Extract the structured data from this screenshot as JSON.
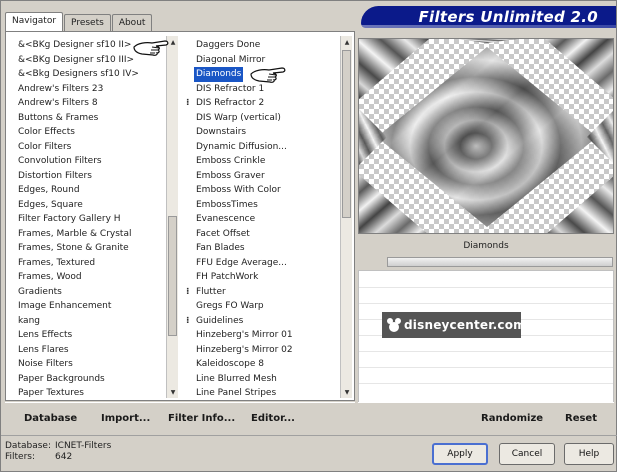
{
  "app": {
    "banner_title": "Filters Unlimited 2.0"
  },
  "tabs": [
    {
      "label": "Navigator",
      "active": true
    },
    {
      "label": "Presets",
      "active": false
    },
    {
      "label": "About",
      "active": false
    }
  ],
  "categories": [
    "&<BKg Designer sf10 II>",
    "&<BKg Designer sf10 III>",
    "&<Bkg Designers sf10 IV>",
    "Andrew's Filters 23",
    "Andrew's Filters 8",
    "Buttons & Frames",
    "Color Effects",
    "Color Filters",
    "Convolution Filters",
    "Distortion Filters",
    "Edges, Round",
    "Edges, Square",
    "Filter Factory Gallery H",
    "Frames, Marble & Crystal",
    "Frames, Stone & Granite",
    "Frames, Textured",
    "Frames, Wood",
    "Gradients",
    "Image Enhancement",
    "kang",
    "Lens Effects",
    "Lens Flares",
    "Noise Filters",
    "Paper Backgrounds",
    "Paper Textures"
  ],
  "filters": [
    {
      "label": "Daggers Done",
      "group": false
    },
    {
      "label": "Diagonal Mirror",
      "group": false
    },
    {
      "label": "Diamonds",
      "group": false,
      "selected": true
    },
    {
      "label": "DIS Refractor 1",
      "group": false
    },
    {
      "label": "DIS Refractor 2",
      "group": true
    },
    {
      "label": "DIS Warp (vertical)",
      "group": false
    },
    {
      "label": "Downstairs",
      "group": false
    },
    {
      "label": "Dynamic Diffusion...",
      "group": false
    },
    {
      "label": "Emboss Crinkle",
      "group": false
    },
    {
      "label": "Emboss Graver",
      "group": false
    },
    {
      "label": "Emboss With Color",
      "group": false
    },
    {
      "label": "EmbossTimes",
      "group": false
    },
    {
      "label": "Evanescence",
      "group": false
    },
    {
      "label": "Facet Offset",
      "group": false
    },
    {
      "label": "Fan Blades",
      "group": false
    },
    {
      "label": "FFU Edge Average...",
      "group": false
    },
    {
      "label": "FH PatchWork",
      "group": false
    },
    {
      "label": "Flutter",
      "group": true
    },
    {
      "label": "Gregs FO Warp",
      "group": false
    },
    {
      "label": "Guidelines",
      "group": true
    },
    {
      "label": "Hinzeberg's Mirror 01",
      "group": false
    },
    {
      "label": "Hinzeberg's Mirror 02",
      "group": false
    },
    {
      "label": "Kaleidoscope 8",
      "group": false
    },
    {
      "label": "Line Blurred Mesh",
      "group": false
    },
    {
      "label": "Line Panel Stripes",
      "group": false
    }
  ],
  "preview": {
    "filter_name": "Diamonds"
  },
  "watermark": {
    "text": "disneycenter.com"
  },
  "left_actions": {
    "database": "Database",
    "import": "Import...",
    "filter_info": "Filter Info...",
    "editor": "Editor..."
  },
  "right_actions": {
    "randomize": "Randomize",
    "reset": "Reset"
  },
  "status": {
    "database_label": "Database:",
    "database_value": "ICNET-Filters",
    "filters_label": "Filters:",
    "filters_value": "642"
  },
  "dialog": {
    "apply": "Apply",
    "cancel": "Cancel",
    "help": "Help"
  },
  "colors": {
    "banner": "#0b1a8a",
    "selection": "#1a56c5",
    "apply_border": "#4a6fd1"
  }
}
